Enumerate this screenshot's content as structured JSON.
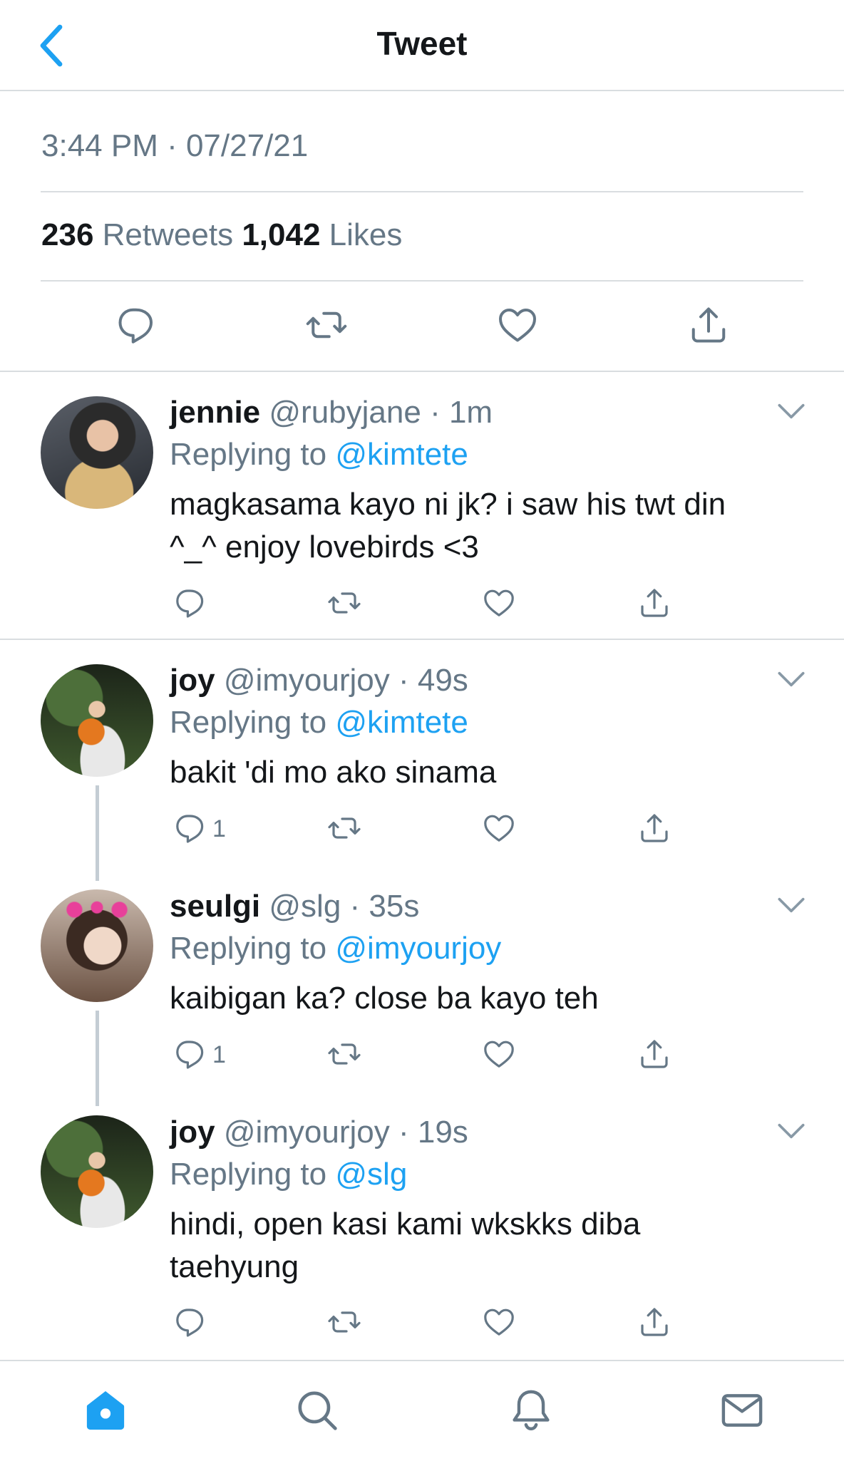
{
  "header": {
    "title": "Tweet",
    "back_icon": "chevron-left-icon"
  },
  "main_tweet": {
    "timestamp": "3:44 PM · 07/27/21",
    "retweets_count": "236",
    "retweets_label": "Retweets",
    "likes_count": "1,042",
    "likes_label": "Likes"
  },
  "replies": [
    {
      "name": "jennie",
      "handle": "@rubyjane",
      "time": "· 1m",
      "replying_label": "Replying to",
      "replying_to": "@kimtete",
      "text": "magkasama kayo ni jk? i saw his twt din ^_^ enjoy lovebirds <3",
      "reply_count": ""
    },
    {
      "name": "joy",
      "handle": "@imyourjoy",
      "time": "· 49s",
      "replying_label": "Replying to",
      "replying_to": "@kimtete",
      "text": "bakit 'di mo ako sinama",
      "reply_count": "1"
    },
    {
      "name": "seulgi",
      "handle": "@slg",
      "time": "· 35s",
      "replying_label": "Replying to",
      "replying_to": "@imyourjoy",
      "text": "kaibigan ka? close ba kayo teh",
      "reply_count": "1"
    },
    {
      "name": "joy",
      "handle": "@imyourjoy",
      "time": "· 19s",
      "replying_label": "Replying to",
      "replying_to": "@slg",
      "text": "hindi, open kasi kami wkskks diba taehyung",
      "reply_count": ""
    }
  ],
  "tabbar": {
    "items": [
      "home-icon",
      "search-icon",
      "bell-icon",
      "mail-icon"
    ],
    "active_color": "#1da1f2"
  },
  "colors": {
    "accent": "#1da1f2",
    "muted": "#657786",
    "text": "#14171a"
  }
}
